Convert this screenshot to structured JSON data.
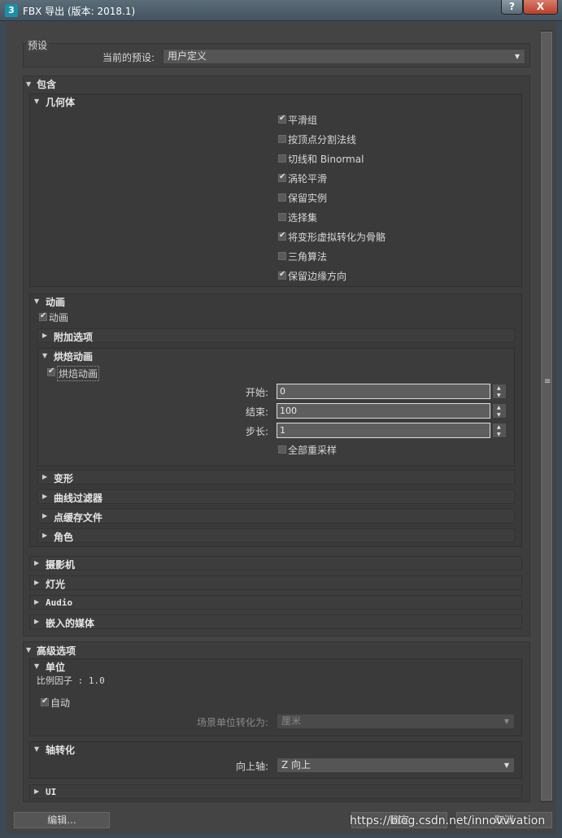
{
  "window": {
    "title": "FBX 导出 (版本: 2018.1)",
    "icon_label": "3",
    "help_label": "?",
    "close_label": "X"
  },
  "preset": {
    "group_label": "预设",
    "current_label": "当前的预设:",
    "value": "用户定义"
  },
  "include": {
    "label": "包含",
    "geometry": {
      "label": "几何体",
      "options": [
        {
          "label": "平滑组",
          "checked": true
        },
        {
          "label": "按顶点分割法线",
          "checked": false
        },
        {
          "label": "切线和 Binormal",
          "checked": false
        },
        {
          "label": "涡轮平滑",
          "checked": true
        },
        {
          "label": "保留实例",
          "checked": false
        },
        {
          "label": "选择集",
          "checked": false
        },
        {
          "label": "将变形虚拟转化为骨骼",
          "checked": true
        },
        {
          "label": "三角算法",
          "checked": false
        },
        {
          "label": "保留边缘方向",
          "checked": true
        }
      ]
    },
    "animation": {
      "label": "动画",
      "checkbox_label": "动画",
      "extra_options_label": "附加选项",
      "bake": {
        "label": "烘焙动画",
        "checkbox_label": "烘焙动画",
        "start_label": "开始:",
        "start_value": "0",
        "end_label": "结束:",
        "end_value": "100",
        "step_label": "步长:",
        "step_value": "1",
        "resample_label": "全部重采样"
      },
      "deform_label": "变形",
      "curve_filter_label": "曲线过滤器",
      "point_cache_label": "点缓存文件",
      "character_label": "角色"
    },
    "camera_label": "摄影机",
    "light_label": "灯光",
    "audio_label": "Audio",
    "embed_media_label": "嵌入的媒体"
  },
  "advanced": {
    "label": "高级选项",
    "units": {
      "label": "单位",
      "scale_factor": "比例因子 : 1.0",
      "auto_label": "自动",
      "convert_label": "场景单位转化为:",
      "convert_value": "厘米"
    },
    "axis": {
      "label": "轴转化",
      "up_axis_label": "向上轴:",
      "up_axis_value": "Z 向上"
    },
    "ui_label": "UI"
  },
  "buttons": {
    "edit": "编辑...",
    "ok": "确定",
    "cancel": "取消"
  },
  "watermark": "https://blog.csdn.net/innovvvation",
  "colors": {
    "window_bg": "#444444",
    "title_bar": "#4f606b",
    "close_button": "#c75a46"
  }
}
